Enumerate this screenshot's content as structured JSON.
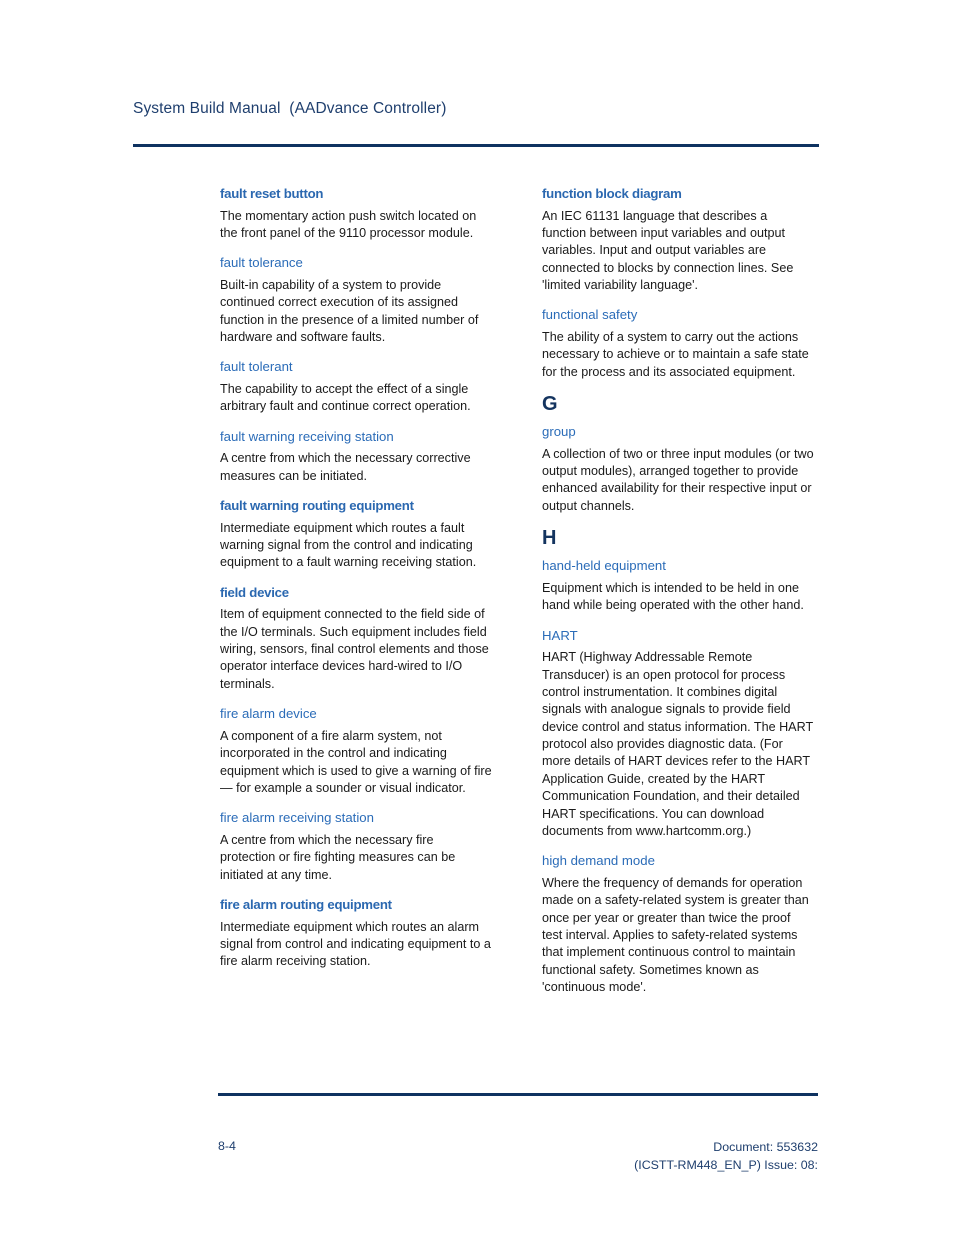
{
  "header": {
    "title": "System Build Manual  (AADvance Controller)"
  },
  "colors": {
    "header_navy": "#1f3f6e",
    "rule_navy": "#0e3260",
    "term_blue": "#2b6cb8",
    "letter_navy": "#14345f",
    "body_text": "#1a1a1a"
  },
  "columns": {
    "left": [
      {
        "kind": "entry",
        "term": "fault reset button",
        "bold": true,
        "definition": "The momentary action push switch located on the front panel of the 9110 processor module."
      },
      {
        "kind": "entry",
        "term": "fault tolerance",
        "bold": false,
        "definition": "Built-in capability of a system to provide continued correct execution of its assigned function in the presence of a limited number of hardware and software faults."
      },
      {
        "kind": "entry",
        "term": "fault tolerant",
        "bold": false,
        "definition": "The capability to accept the effect of a single arbitrary fault and continue correct operation."
      },
      {
        "kind": "entry",
        "term": "fault warning receiving station",
        "bold": false,
        "definition": "A centre from which the necessary corrective measures can be initiated."
      },
      {
        "kind": "entry",
        "term": "fault warning routing equipment",
        "bold": true,
        "definition": "Intermediate equipment which routes a fault warning signal from the control and indicating equipment to a fault warning receiving station."
      },
      {
        "kind": "entry",
        "term": "field device",
        "bold": true,
        "definition": "Item of equipment connected to the field side of the I/O terminals. Such equipment includes field wiring, sensors, final control elements and those operator interface devices hard-wired to I/O terminals."
      },
      {
        "kind": "entry",
        "term": "fire alarm device",
        "bold": false,
        "definition": "A component of a fire alarm system, not incorporated in the control and indicating equipment which is used to give a warning of fire — for example a sounder or visual indicator."
      },
      {
        "kind": "entry",
        "term": "fire alarm receiving station",
        "bold": false,
        "definition": "A centre from which the necessary fire protection or fire fighting measures can be initiated at any time."
      },
      {
        "kind": "entry",
        "term": "fire alarm routing equipment",
        "bold": true,
        "definition": "Intermediate equipment which routes an alarm signal from control and indicating equipment to a fire alarm receiving station."
      }
    ],
    "right": [
      {
        "kind": "entry",
        "term": "function block diagram",
        "bold": true,
        "definition": "An IEC 61131 language that describes a function between input variables and output variables. Input and output variables are connected to blocks by connection lines. See 'limited variability language'."
      },
      {
        "kind": "entry",
        "term": "functional safety",
        "bold": false,
        "definition": "The ability of a system to carry out the actions necessary to achieve or to maintain a safe state for the process and its associated equipment."
      },
      {
        "kind": "letter",
        "letter": "G"
      },
      {
        "kind": "entry",
        "term": "group",
        "bold": false,
        "definition": "A collection of two or three input modules (or two output modules), arranged together to provide enhanced availability for their respective input or output channels."
      },
      {
        "kind": "letter",
        "letter": "H"
      },
      {
        "kind": "entry",
        "term": "hand-held equipment",
        "bold": false,
        "definition": "Equipment which is intended to be held in one hand while being operated with the other hand."
      },
      {
        "kind": "entry",
        "term": "HART",
        "bold": false,
        "definition": "HART (Highway Addressable Remote Transducer) is an open protocol for process control instrumentation. It combines digital signals with analogue signals to provide field device control and status information. The HART protocol also provides diagnostic data. (For more details of HART devices refer to the HART Application Guide, created by the HART Communication Foundation, and their detailed HART specifications. You can download documents from www.hartcomm.org.)"
      },
      {
        "kind": "entry",
        "term": "high demand mode",
        "bold": false,
        "definition": "Where the frequency of demands for operation made on a safety-related system is greater than once per year or greater than twice the proof test interval. Applies to safety-related systems that implement continuous control to maintain functional safety. Sometimes known as 'continuous mode'."
      }
    ]
  },
  "footer": {
    "page_number": "8-4",
    "document_line1": "Document: 553632",
    "document_line2": "(ICSTT-RM448_EN_P) Issue: 08:"
  }
}
